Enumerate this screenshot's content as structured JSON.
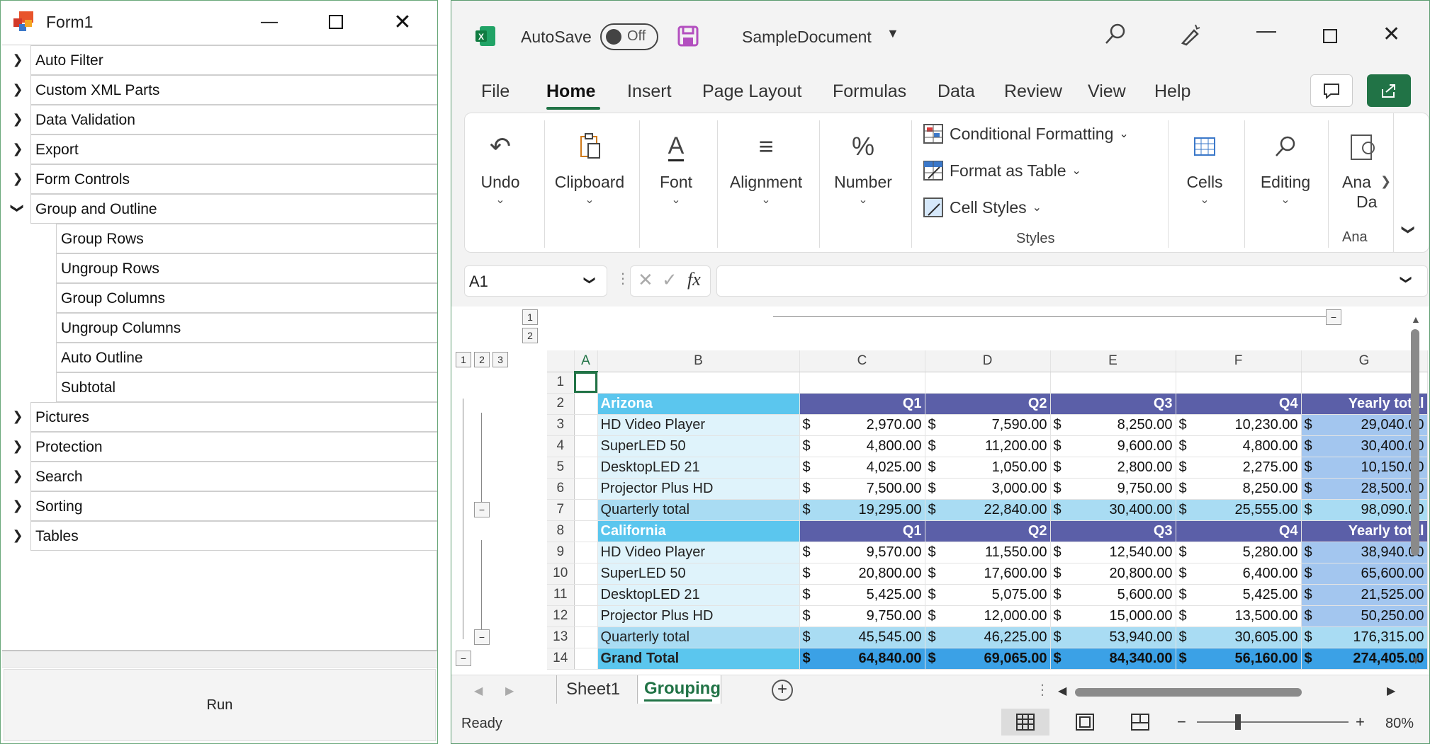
{
  "form": {
    "title": "Form1",
    "tree_items": [
      "Auto Filter",
      "Custom XML Parts",
      "Data Validation",
      "Export",
      "Form Controls",
      "Group and Outline",
      "Group Rows",
      "Ungroup Rows",
      "Group Columns",
      "Ungroup Columns",
      "Auto Outline",
      "Subtotal",
      "Pictures",
      "Protection",
      "Search",
      "Sorting",
      "Tables"
    ],
    "run_label": "Run"
  },
  "excel": {
    "autosave": "AutoSave",
    "autosave_state": "Off",
    "doc_name": "SampleDocument",
    "tabs": [
      "File",
      "Home",
      "Insert",
      "Page Layout",
      "Formulas",
      "Data",
      "Review",
      "View",
      "Help"
    ],
    "ribbon": {
      "undo": "Undo",
      "clipboard": "Clipboard",
      "font": "Font",
      "alignment": "Alignment",
      "number": "Number",
      "conditional": "Conditional Formatting",
      "format_table": "Format as Table",
      "cell_styles": "Cell Styles",
      "styles": "Styles",
      "cells": "Cells",
      "editing": "Editing",
      "analyze1": "Ana",
      "analyze2": "Da",
      "analyze3": "Ana"
    },
    "name_box": "A1",
    "fx": "fx",
    "col_letters": [
      "A",
      "B",
      "C",
      "D",
      "E",
      "F",
      "G"
    ],
    "outline_levels_col": [
      "1",
      "2"
    ],
    "outline_levels_row": [
      "1",
      "2",
      "3"
    ],
    "rows": [
      {
        "n": "1",
        "b": "",
        "c": "",
        "d": "",
        "e": "",
        "f": "",
        "g": "",
        "kind": "blank"
      },
      {
        "n": "2",
        "b": "Arizona",
        "c": "Q1",
        "d": "Q2",
        "e": "Q3",
        "f": "Q4",
        "g": "Yearly total",
        "kind": "header"
      },
      {
        "n": "3",
        "b": "HD Video Player",
        "c": "2,970.00",
        "d": "7,590.00",
        "e": "8,250.00",
        "f": "10,230.00",
        "g": "29,040.00",
        "kind": "item"
      },
      {
        "n": "4",
        "b": "SuperLED 50",
        "c": "4,800.00",
        "d": "11,200.00",
        "e": "9,600.00",
        "f": "4,800.00",
        "g": "30,400.00",
        "kind": "item"
      },
      {
        "n": "5",
        "b": "DesktopLED 21",
        "c": "4,025.00",
        "d": "1,050.00",
        "e": "2,800.00",
        "f": "2,275.00",
        "g": "10,150.00",
        "kind": "item"
      },
      {
        "n": "6",
        "b": "Projector Plus HD",
        "c": "7,500.00",
        "d": "3,000.00",
        "e": "9,750.00",
        "f": "8,250.00",
        "g": "28,500.00",
        "kind": "item"
      },
      {
        "n": "7",
        "b": "Quarterly total",
        "c": "19,295.00",
        "d": "22,840.00",
        "e": "30,400.00",
        "f": "25,555.00",
        "g": "98,090.00",
        "kind": "qtotal"
      },
      {
        "n": "8",
        "b": "California",
        "c": "Q1",
        "d": "Q2",
        "e": "Q3",
        "f": "Q4",
        "g": "Yearly total",
        "kind": "header"
      },
      {
        "n": "9",
        "b": "HD Video Player",
        "c": "9,570.00",
        "d": "11,550.00",
        "e": "12,540.00",
        "f": "5,280.00",
        "g": "38,940.00",
        "kind": "item"
      },
      {
        "n": "10",
        "b": "SuperLED 50",
        "c": "20,800.00",
        "d": "17,600.00",
        "e": "20,800.00",
        "f": "6,400.00",
        "g": "65,600.00",
        "kind": "item"
      },
      {
        "n": "11",
        "b": "DesktopLED 21",
        "c": "5,425.00",
        "d": "5,075.00",
        "e": "5,600.00",
        "f": "5,425.00",
        "g": "21,525.00",
        "kind": "item"
      },
      {
        "n": "12",
        "b": "Projector Plus HD",
        "c": "9,750.00",
        "d": "12,000.00",
        "e": "15,000.00",
        "f": "13,500.00",
        "g": "50,250.00",
        "kind": "item"
      },
      {
        "n": "13",
        "b": "Quarterly total",
        "c": "45,545.00",
        "d": "46,225.00",
        "e": "53,940.00",
        "f": "30,605.00",
        "g": "176,315.00",
        "kind": "qtotal"
      },
      {
        "n": "14",
        "b": "Grand Total",
        "c": "64,840.00",
        "d": "69,065.00",
        "e": "84,340.00",
        "f": "56,160.00",
        "g": "274,405.00",
        "kind": "grand"
      }
    ],
    "currency": "$",
    "sheets": [
      "Sheet1",
      "Grouping"
    ],
    "status": "Ready",
    "zoom": "80%",
    "colors": {
      "accent": "#217346",
      "header_dark": "#5b5fa8",
      "label_light": "#5bc6ee",
      "cell_light": "#dff3fb",
      "qtotal": "#a9dcf3",
      "grand": "#3ba1e6",
      "col_g": "#a3c6ef"
    }
  }
}
